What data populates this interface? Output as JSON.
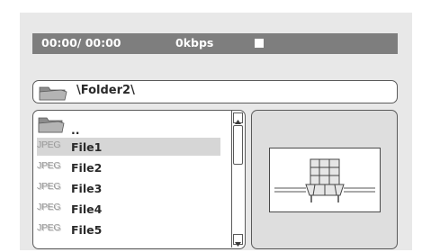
{
  "status_bar": {
    "time": "00:00/ 00:00",
    "bitrate": "0kbps",
    "stop_icon": "stop-square-icon"
  },
  "path": {
    "icon": "folder-icon",
    "text": "\\Folder2\\"
  },
  "file_list": {
    "parent_label": "..",
    "parent_icon": "folder-icon",
    "type_badge": "JPEG",
    "items": [
      {
        "name": "File1",
        "selected": true
      },
      {
        "name": "File2",
        "selected": false
      },
      {
        "name": "File3",
        "selected": false
      },
      {
        "name": "File4",
        "selected": false
      },
      {
        "name": "File5",
        "selected": false
      }
    ]
  },
  "preview": {
    "icon": "photo-placeholder-icon"
  },
  "colors": {
    "panel": "#e8e8e8",
    "status_bar": "#7e7e7e",
    "selection": "#d6d6d6"
  }
}
